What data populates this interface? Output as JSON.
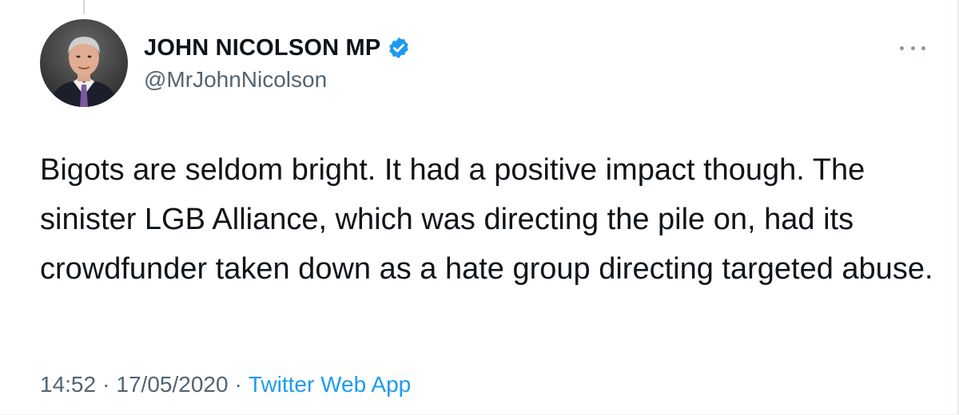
{
  "author": {
    "display_name": "JOHN NICOLSON MP",
    "handle": "@MrJohnNicolson",
    "verified": true,
    "avatar_icon": "profile-photo-icon"
  },
  "tweet": {
    "text": "Bigots are seldom bright. It had a positive impact though. The sinister LGB Alliance, which was directing the pile on, had its crowdfunder taken down as a hate group directing targeted abuse.",
    "time": "14:52",
    "date": "17/05/2020",
    "separator": "·",
    "source": "Twitter Web App"
  },
  "icons": {
    "verified": "verified-badge-icon",
    "more": "more-options-icon"
  },
  "colors": {
    "accent": "#1d9bf0",
    "text_primary": "#0f1419",
    "text_secondary": "#536471"
  }
}
